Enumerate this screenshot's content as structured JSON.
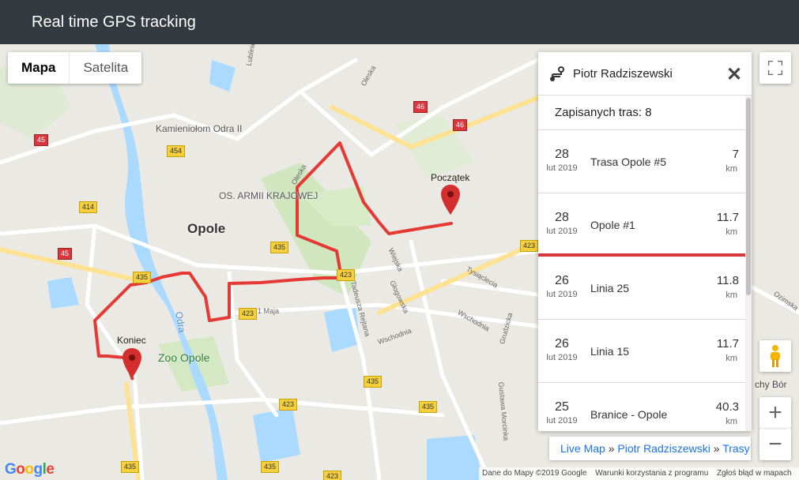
{
  "header": {
    "title": "Real time GPS tracking"
  },
  "map": {
    "type_control": {
      "map_label": "Mapa",
      "satellite_label": "Satelita"
    },
    "city_label": "Opole",
    "place_labels": {
      "quarry": "Kamieniołom Odra II",
      "armia": "OS. ARMII KRAJOWEJ",
      "zoo": "Zoo Opole",
      "river": "Odra",
      "chuchy": "chy Bór"
    },
    "street_labels": {
      "oleska": "Oleska",
      "oleska2": "Oleska",
      "wiejska": "Wiejska",
      "glogowska": "Głogowska",
      "wschodnia": "Wschodnia",
      "wschodnia2": "Wschodnia",
      "tysiaclecia": "Tysiąclecia",
      "grudzicka": "Grudzicka",
      "1maja": "1 Maja",
      "reymonta": "Tadeusza Rejtana",
      "mocranka": "Gustawa Morcinka",
      "ozimska": "Ozimska",
      "lubliniecka": "Lubliniecka"
    },
    "road_shields": {
      "s46a": "46",
      "s46b": "46",
      "s45a": "45",
      "s45b": "45",
      "s454": "454",
      "s414": "414",
      "s435a": "435",
      "s435b": "435",
      "s435c": "435",
      "s435d": "435",
      "s423a": "423",
      "s423b": "423",
      "s423c": "423",
      "s423d": "423",
      "s435e": "435",
      "s435f": "435",
      "s423e": "423"
    },
    "start_label": "Początek",
    "end_label": "Koniec",
    "marker_color": "#d32f2f",
    "route_color": "#e53935",
    "footer": {
      "data": "Dane do Mapy ©2019 Google",
      "terms": "Warunki korzystania z programu",
      "report": "Zgłoś błąd w mapach"
    },
    "google_logo": "Google"
  },
  "panel": {
    "user_name": "Piotr Radziszewski",
    "saved_routes": "Zapisanych tras: 8",
    "routes": [
      {
        "day": "28",
        "month": "lut 2019",
        "name": "Trasa Opole #5",
        "distance": "7",
        "unit": "km",
        "active": false
      },
      {
        "day": "28",
        "month": "lut 2019",
        "name": "Opole #1",
        "distance": "11.7",
        "unit": "km",
        "active": true
      },
      {
        "day": "26",
        "month": "lut 2019",
        "name": "Linia 25",
        "distance": "11.8",
        "unit": "km",
        "active": false
      },
      {
        "day": "26",
        "month": "lut 2019",
        "name": "Linia 15",
        "distance": "11.7",
        "unit": "km",
        "active": false
      },
      {
        "day": "25",
        "month": "lut 2019",
        "name": "Branice - Opole",
        "distance": "40.3",
        "unit": "km",
        "active": false
      }
    ]
  },
  "breadcrumb": {
    "item1": "Live Map",
    "sep": "»",
    "item2": "Piotr Radziszewski",
    "item3": "Trasy"
  },
  "controls": {
    "zoom_in": "+",
    "zoom_out": "−"
  }
}
